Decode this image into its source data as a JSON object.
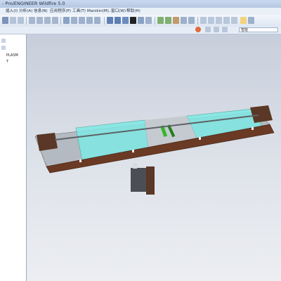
{
  "window": {
    "title": "- Pro/ENGINEER Wildfire 5.0"
  },
  "menu": [
    {
      "label": "插入(I)"
    },
    {
      "label": "分析(A)"
    },
    {
      "label": "信息(N)"
    },
    {
      "label": "应用程序(P)"
    },
    {
      "label": "工具(T)"
    },
    {
      "label": "Manikin(M)..."
    },
    {
      "label": "窗口(W)"
    },
    {
      "label": "帮助(H)"
    }
  ],
  "toolbar2": {
    "filter_value": "智能"
  },
  "navigator": {
    "items": [
      {
        "label": "PLASM"
      },
      {
        "label": "T"
      }
    ]
  },
  "colors": {
    "glass": "#7fe8e3",
    "frame": "#6b3a24",
    "rail": "#8d949c",
    "viewport_bg": "#c7cedb"
  }
}
